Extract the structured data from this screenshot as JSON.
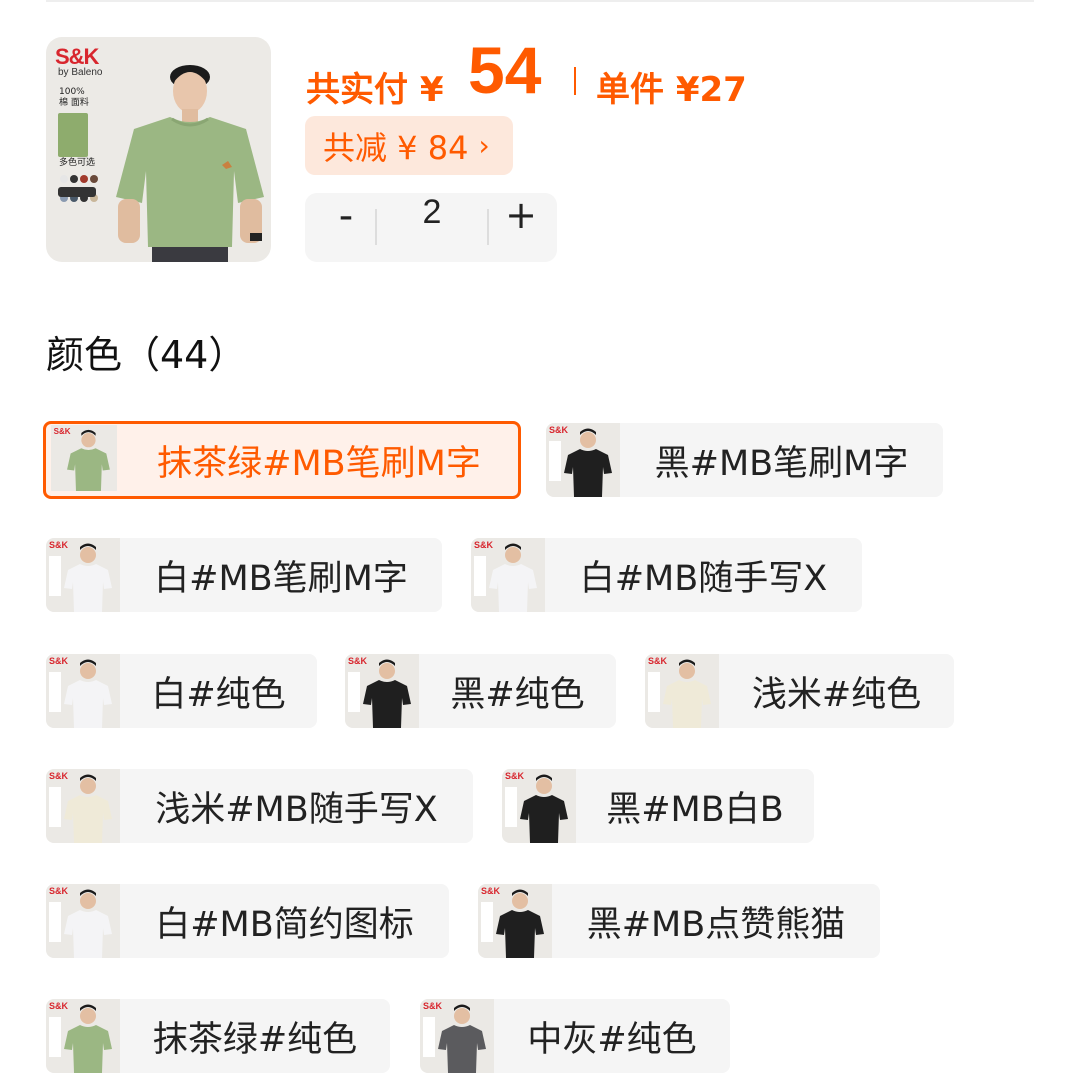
{
  "header": {
    "pay_label": "共实付 ¥",
    "pay_amount": "54",
    "unit_label": "单件 ¥27"
  },
  "product": {
    "brand": "S&K",
    "brand_sub": "by Baleno",
    "image_tag_material": "100%棉 面料",
    "image_tag_colors": "多色可选",
    "shirt_color": "#9bb783"
  },
  "discount": {
    "label": "共减 ¥ 84",
    "chevron_icon": "chevron-right-icon"
  },
  "quantity": {
    "minus": "-",
    "value": "2",
    "plus": "+"
  },
  "colors": {
    "title": "颜色（44）",
    "options": [
      {
        "label": "抹茶绿#MB笔刷M字",
        "shirt": "#9bb783",
        "selected": true
      },
      {
        "label": "黑#MB笔刷M字",
        "shirt": "#1f1f1f",
        "selected": false
      },
      {
        "label": "白#MB笔刷M字",
        "shirt": "#f4f4f6",
        "selected": false
      },
      {
        "label": "白#MB随手写X",
        "shirt": "#f4f4f6",
        "selected": false
      },
      {
        "label": "白#纯色",
        "shirt": "#f4f4f6",
        "selected": false
      },
      {
        "label": "黑#纯色",
        "shirt": "#1f1f1f",
        "selected": false
      },
      {
        "label": "浅米#纯色",
        "shirt": "#efead8",
        "selected": false
      },
      {
        "label": "浅米#MB随手写X",
        "shirt": "#efead8",
        "selected": false
      },
      {
        "label": "黑#MB白B",
        "shirt": "#1f1f1f",
        "selected": false
      },
      {
        "label": "白#MB简约图标",
        "shirt": "#f4f4f6",
        "selected": false
      },
      {
        "label": "黑#MB点赞熊猫",
        "shirt": "#1f1f1f",
        "selected": false
      },
      {
        "label": "抹茶绿#纯色",
        "shirt": "#9bb783",
        "selected": false
      },
      {
        "label": "中灰#纯色",
        "shirt": "#5b5b5e",
        "selected": false
      }
    ]
  },
  "accent_color": "#ff5a00"
}
